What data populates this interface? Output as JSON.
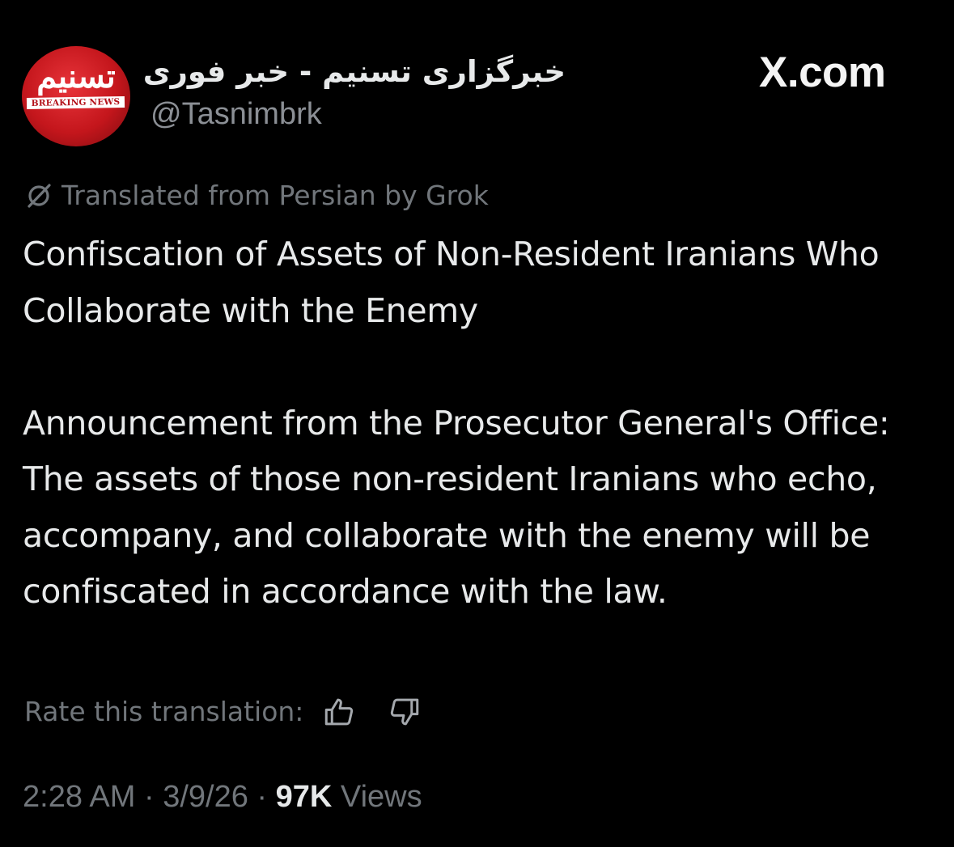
{
  "account": {
    "display_name": "خبرگزاری تسنیم - خبر فوری",
    "handle": "@Tasnimbrk",
    "avatar": {
      "script_text": "تسنیم",
      "banner_text": "BREAKING NEWS",
      "icon": "tasnim-breaking-news-logo"
    }
  },
  "source_label": "X.com",
  "translation": {
    "icon": "grok-icon",
    "note": "Translated from Persian by Grok"
  },
  "post": {
    "title": "Confiscation of Assets of Non-Resident Iranians Who Collaborate with the Enemy",
    "body": "Announcement from the Prosecutor General's Office: The assets of those non-resident Iranians who echo, accompany, and collaborate with the enemy will be confiscated in accordance with the law."
  },
  "rating": {
    "label": "Rate this translation:",
    "thumbs_up_icon": "thumbs-up-icon",
    "thumbs_down_icon": "thumbs-down-icon"
  },
  "meta": {
    "time": "2:28 AM",
    "separator": " · ",
    "date": "3/9/26",
    "views_count": "97K",
    "views_label": " Views"
  },
  "colors": {
    "background": "#000000",
    "text_primary": "#e7e9ea",
    "text_secondary": "#71767b",
    "brand_red": "#c4161c"
  }
}
